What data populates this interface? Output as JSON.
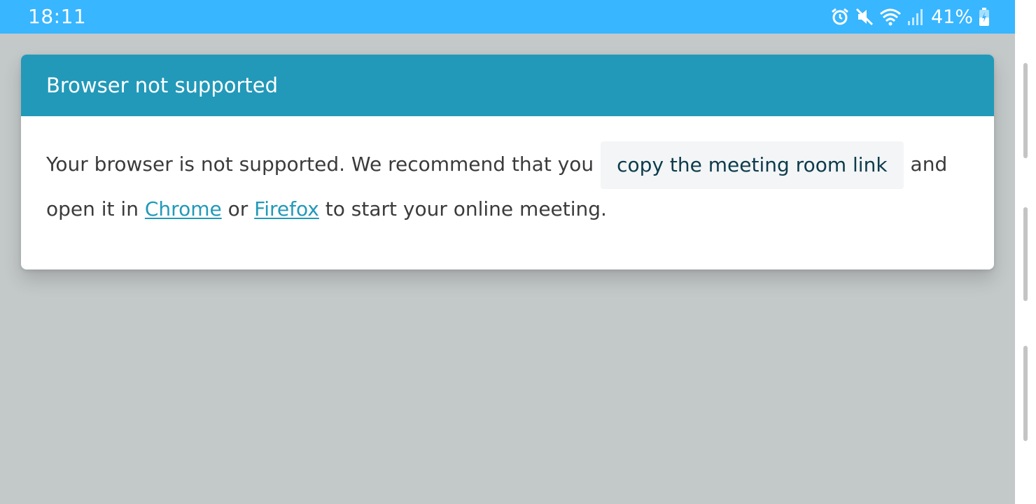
{
  "status_bar": {
    "time": "18:11",
    "battery_percent": "41%",
    "icons": [
      "alarm-icon",
      "mute-icon",
      "wifi-icon",
      "signal-icon",
      "battery-charging-icon"
    ]
  },
  "dialog": {
    "title": "Browser not supported",
    "message": {
      "line1_before": "Your browser is not supported. We recommend that you",
      "copy_link_label": "copy the meeting room link",
      "line1_after": "and",
      "line2_before": "open it in",
      "chrome_link": "Chrome",
      "conjunction": "or",
      "firefox_link": "Firefox",
      "line2_after": "to start your online meeting."
    }
  },
  "colors": {
    "status_bar": "#38b6ff",
    "header": "#2299b9",
    "link": "#2299b9",
    "backdrop": "#c3c8c9"
  }
}
